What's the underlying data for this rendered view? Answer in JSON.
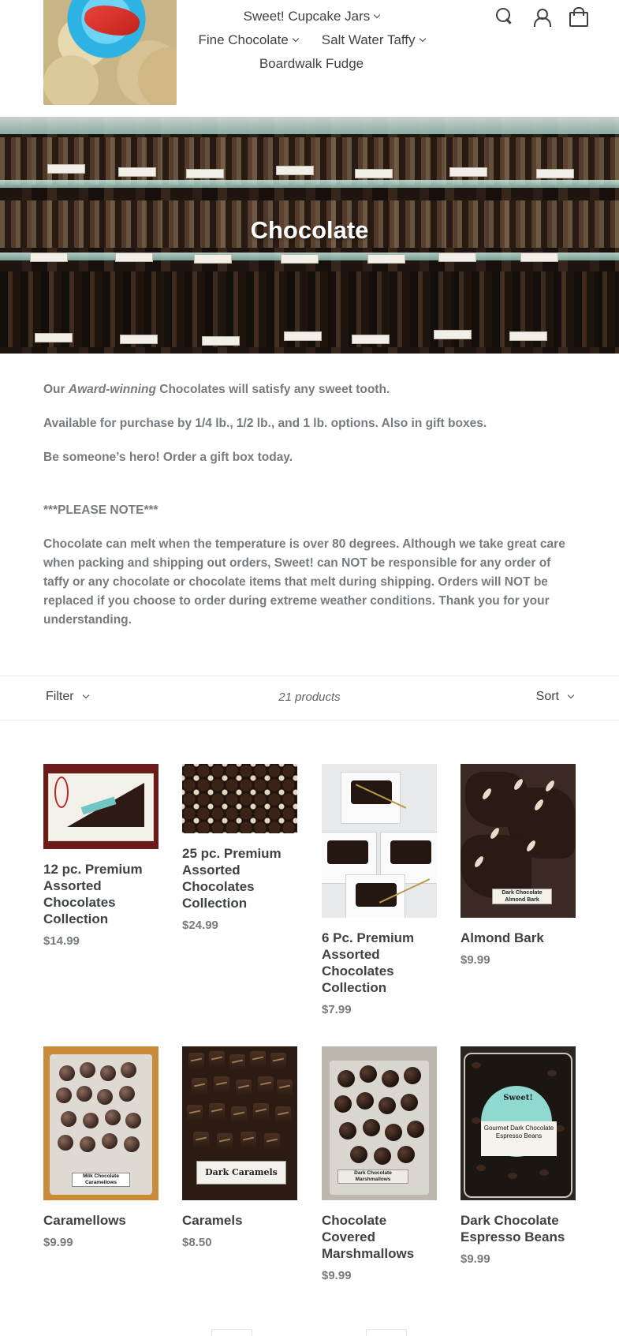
{
  "nav": {
    "items": [
      {
        "label": "Sweet! Cupcake Jars",
        "has_dropdown": true
      },
      {
        "label": "Fine Chocolate",
        "has_dropdown": true
      },
      {
        "label": "Salt Water Taffy",
        "has_dropdown": true
      },
      {
        "label": "Boardwalk Fudge",
        "has_dropdown": false
      }
    ],
    "icons": [
      "search-icon",
      "account-icon",
      "cart-icon"
    ]
  },
  "hero": {
    "title": "Chocolate"
  },
  "description": {
    "p1_pre": "Our ",
    "p1_em": "Award-winning",
    "p1_post": " Chocolates will satisfy any sweet tooth.",
    "p2": "Available for purchase by 1/4 lb., 1/2 lb., and  1 lb. options. Also in gift boxes.",
    "p3": "Be someone’s hero! Order a gift box today.",
    "note_heading": "***PLEASE NOTE***",
    "note_body": "Chocolate can melt when the temperature is over 80 degrees. Although we take great care when packing and shipping out orders, Sweet! can NOT be responsible for any order of taffy or any chocolate or chocolate items that melt during shipping. Orders will NOT be replaced if you choose to order during extreme weather conditions. Thank you for your understanding."
  },
  "toolbar": {
    "filter_label": "Filter",
    "count_label": "21 products",
    "sort_label": "Sort"
  },
  "products": [
    {
      "title": "12 pc. Premium Assorted Chocolates Collection",
      "price": "$14.99"
    },
    {
      "title": "25 pc. Premium Assorted Chocolates Collection",
      "price": "$24.99"
    },
    {
      "title": "6 Pc. Premium Assorted Chocolates Collection",
      "price": "$7.99"
    },
    {
      "title": "Almond Bark",
      "price": "$9.99",
      "image_label": "Dark Chocolate Almond Bark"
    },
    {
      "title": "Caramellows",
      "price": "$9.99",
      "image_label": "Milk Chocolate Caramellows"
    },
    {
      "title": "Caramels",
      "price": "$8.50",
      "image_label": "Dark Caramels"
    },
    {
      "title": "Chocolate Covered Marshmallows",
      "price": "$9.99",
      "image_label": "Dark Chocolate Marshmallows"
    },
    {
      "title": "Dark Chocolate Espresso Beans",
      "price": "$9.99",
      "image_label": "Gourmet Dark Chocolate Espresso Beans",
      "image_brand": "Sweet!"
    }
  ],
  "colors": {
    "nav_text": "#3d4246",
    "body_text": "#767b80",
    "border": "#e8e9eb"
  }
}
